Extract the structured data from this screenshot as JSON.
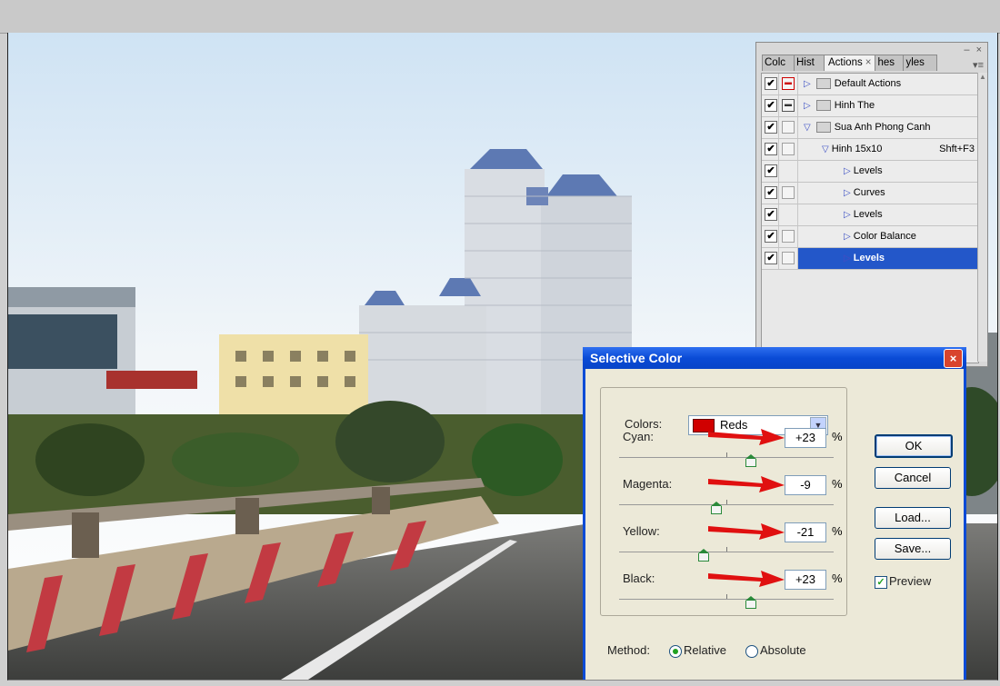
{
  "actions_panel": {
    "tabs": [
      {
        "label": "Colc",
        "active": false
      },
      {
        "label": "Hist",
        "active": false
      },
      {
        "label": "Actions",
        "active": true,
        "close": "×"
      },
      {
        "label": "hes",
        "active": false
      },
      {
        "label": "yles",
        "active": false
      }
    ],
    "window_controls": "– ×",
    "menu_icon": "▾≡",
    "rows": [
      {
        "label": "Default Actions",
        "checked": true,
        "dialog": "red",
        "type": "set",
        "expanded": false
      },
      {
        "label": "Hinh The",
        "checked": true,
        "dialog": "dark",
        "type": "set",
        "expanded": false
      },
      {
        "label": "Sua Anh Phong Canh",
        "checked": true,
        "dialog": "empty",
        "type": "set",
        "expanded": true
      },
      {
        "label": "Hinh 15x10",
        "checked": true,
        "dialog": "empty",
        "type": "action",
        "expanded": true,
        "shortcut": "Shft+F3"
      },
      {
        "label": "Levels",
        "checked": true,
        "dialog": "none",
        "type": "step"
      },
      {
        "label": "Curves",
        "checked": true,
        "dialog": "empty",
        "type": "step"
      },
      {
        "label": "Levels",
        "checked": true,
        "dialog": "none",
        "type": "step"
      },
      {
        "label": "Color Balance",
        "checked": true,
        "dialog": "empty",
        "type": "step"
      },
      {
        "label": "Levels",
        "checked": true,
        "dialog": "empty",
        "type": "step",
        "selected": true
      }
    ]
  },
  "dialog": {
    "title": "Selective Color",
    "close_icon": "×",
    "colors_label": "Colors:",
    "colors_value": "Reds",
    "colors_swatch": "#d00000",
    "sliders": [
      {
        "label": "Cyan:",
        "value": "+23",
        "unit": "%",
        "level": 0.615
      },
      {
        "label": "Magenta:",
        "value": "-9",
        "unit": "%",
        "level": 0.455
      },
      {
        "label": "Yellow:",
        "value": "-21",
        "unit": "%",
        "level": 0.395
      },
      {
        "label": "Black:",
        "value": "+23",
        "unit": "%",
        "level": 0.615
      }
    ],
    "buttons": {
      "ok": "OK",
      "cancel": "Cancel",
      "load": "Load...",
      "save": "Save..."
    },
    "preview_label": "Preview",
    "preview_checked": true,
    "method_label": "Method:",
    "method_options": [
      "Relative",
      "Absolute"
    ],
    "method_selected": "Relative"
  },
  "colors": {
    "accent": "#0a4bd6",
    "selection": "#2357c9",
    "annotation_arrow": "#e01010"
  }
}
